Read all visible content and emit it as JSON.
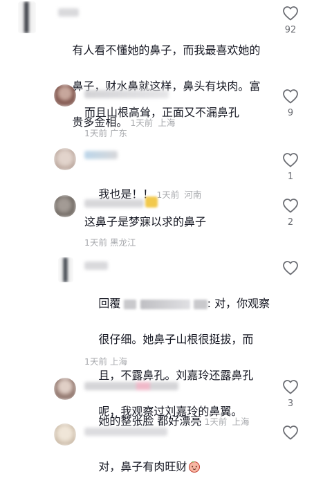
{
  "comments": [
    {
      "text": "有人看不懂她的鼻子，而我最喜欢她的鼻子，财水鼻就这样，鼻头有块肉。富贵多金相。",
      "line1": "有人看不懂她的鼻子，而我最喜欢她的",
      "line2": "鼻子，财水鼻就这样，鼻头有块肉。富",
      "line3": "贵多金相。",
      "time": "1天前",
      "location": "上海",
      "likes": "92"
    },
    {
      "text": "而且山根高耸，正面又不漏鼻孔",
      "time": "1天前",
      "location": "广东",
      "likes": "9"
    },
    {
      "text": "我也是！！",
      "time": "1天前",
      "location": "河南",
      "likes": "1"
    },
    {
      "text": "这鼻子是梦寐以求的鼻子",
      "time": "1天前",
      "location": "黑龙江",
      "likes": "2"
    },
    {
      "reply_prefix": "回覆",
      "text_after": ": 对，你观察",
      "line2": "很仔细。她鼻子山根很挺拔，而",
      "line3": "且，不露鼻孔。刘嘉玲还露鼻孔",
      "line4": "呢，我观察过刘嘉玲的鼻翼。",
      "time": "1天前",
      "location": "上海",
      "likes": ""
    },
    {
      "text": "她的整张脸 都好漂亮",
      "time": "1天前",
      "location": "上海",
      "likes": "3"
    },
    {
      "text": "对，鼻子有肉旺财",
      "time": "",
      "location": "",
      "likes": ""
    }
  ],
  "icons": {
    "like": "heart-outline-icon",
    "emoji": "peach-face-emoji"
  },
  "colors": {
    "text": "#161823",
    "meta": "#a8aaae",
    "count": "#6b6d73"
  }
}
